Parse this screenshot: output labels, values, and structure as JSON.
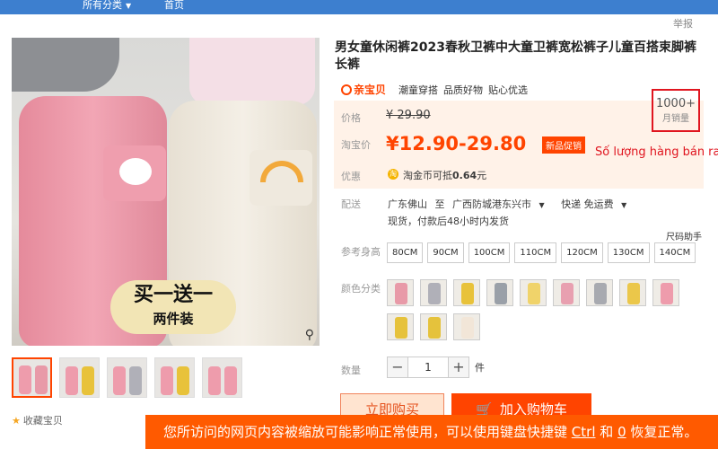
{
  "nav": {
    "all_categories": "所有分类",
    "home": "首页"
  },
  "report": "举报",
  "product": {
    "title": "男女童休闲裤2023春秋卫裤中大童卫裤宽松裤子儿童百搭束脚裤长裤",
    "image_promo_line1": "买一送一",
    "image_promo_line2": "两件装"
  },
  "brand": {
    "logo_text": "亲宝贝",
    "tags": [
      "潮童穿搭",
      "品质好物",
      "贴心优选"
    ]
  },
  "price": {
    "orig_label": "价格",
    "orig_value": "¥ 29.90",
    "cur_label": "淘宝价",
    "cur_value": "¥12.90-29.80",
    "promo_tag": "新品促销",
    "discount_label": "优惠",
    "coin_icon": "淘",
    "coin_text": "淘金币可抵",
    "coin_amount": "0.64",
    "coin_unit": "元"
  },
  "sales": {
    "count": "1000+",
    "label": "月销量"
  },
  "annotation": "Số lượng hàng bán ra",
  "shipping": {
    "label": "配送",
    "from": "广东佛山",
    "to_word": "至",
    "to": "广西防城港东兴市",
    "method": "快递 免运费",
    "sub": "现货，付款后48小时内发货"
  },
  "size": {
    "help": "尺码助手",
    "label": "参考身高",
    "options": [
      "80CM",
      "90CM",
      "100CM",
      "110CM",
      "120CM",
      "130CM",
      "140CM"
    ]
  },
  "color": {
    "label": "颜色分类",
    "swatch_colors": [
      "#e89aa8",
      "#b0b0b8",
      "#e8c23a",
      "#9aa0a8",
      "#f0d36a",
      "#e8a0b0",
      "#a8aab0",
      "#ebc74a",
      "#ee9cac",
      "#e6c23b",
      "#e5c23c",
      "#f2e6d8"
    ]
  },
  "quantity": {
    "label": "数量",
    "minus": "−",
    "value": "1",
    "plus": "+",
    "unit": "件"
  },
  "actions": {
    "buy_now": "立即购买",
    "add_to_cart": "加入购物车"
  },
  "favorite": {
    "label": "收藏宝贝"
  },
  "thumb_colors": [
    "#e89aa8",
    "#e8c23a",
    "#b0b0b8",
    "#e8c23a",
    "#ee9cac"
  ],
  "zoom_banner": {
    "text1": "您所访问的网页内容被缩放可能影响正常使用，可以使用键盘快捷键",
    "key1": "Ctrl",
    "text2": "和",
    "key2": "0",
    "text3": "恢复正常。"
  },
  "colors": {
    "accent": "#ff4400",
    "nav": "#3d7fcf",
    "price_bg": "#fff2e8",
    "annotation": "#e0151f"
  }
}
